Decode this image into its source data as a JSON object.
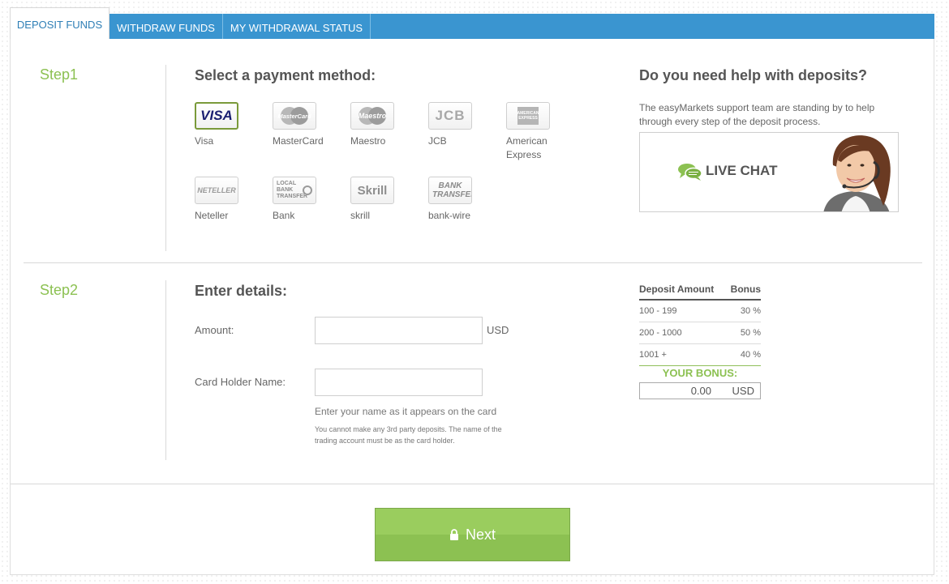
{
  "tabs": [
    {
      "label": "DEPOSIT FUNDS",
      "active": true
    },
    {
      "label": "WITHDRAW FUNDS",
      "active": false
    },
    {
      "label": "MY WITHDRAWAL STATUS",
      "active": false
    }
  ],
  "step1": {
    "label": "Step1",
    "heading": "Select a payment method:",
    "methods": [
      {
        "name": "Visa",
        "logo": "VISA",
        "selected": true
      },
      {
        "name": "MasterCard",
        "logo": "MasterCard"
      },
      {
        "name": "Maestro",
        "logo": "Maestro"
      },
      {
        "name": "JCB",
        "logo": "JCB"
      },
      {
        "name": "American Express",
        "logo": "AMERICAN EXPRESS"
      },
      {
        "name": "Neteller",
        "logo": "NETELLER"
      },
      {
        "name": "Bank",
        "logo": "LOCAL BANK TRANSFER"
      },
      {
        "name": "skrill",
        "logo": "Skrill"
      },
      {
        "name": "bank-wire",
        "logo": "BANK TRANSFER"
      }
    ]
  },
  "help": {
    "heading": "Do you need help with deposits?",
    "text": "The easyMarkets support team are standing by to help through every step of the deposit process.",
    "live_chat_label": "LIVE CHAT"
  },
  "step2": {
    "label": "Step2",
    "heading": "Enter details:",
    "amount_label": "Amount:",
    "amount_value": "",
    "amount_unit": "USD",
    "card_holder_label": "Card Holder Name:",
    "card_holder_value": "",
    "hint": "Enter your name as it appears on the card",
    "note": "You cannot make any 3rd party deposits. The name of the trading account must be as the card holder."
  },
  "bonus_table": {
    "col_amount": "Deposit Amount",
    "col_bonus": "Bonus",
    "rows": [
      {
        "range": "100 - 199",
        "bonus": "30 %"
      },
      {
        "range": "200 - 1000",
        "bonus": "50 %"
      },
      {
        "range": "1001 +",
        "bonus": "40 %"
      }
    ],
    "your_bonus_label": "YOUR BONUS:",
    "your_bonus_value": "0.00",
    "your_bonus_unit": "USD"
  },
  "next_button": {
    "label": "Next"
  },
  "colors": {
    "tab_bar": "#3a95d0",
    "accent_green": "#8cc152",
    "active_tab_text": "#2f7fb6"
  }
}
